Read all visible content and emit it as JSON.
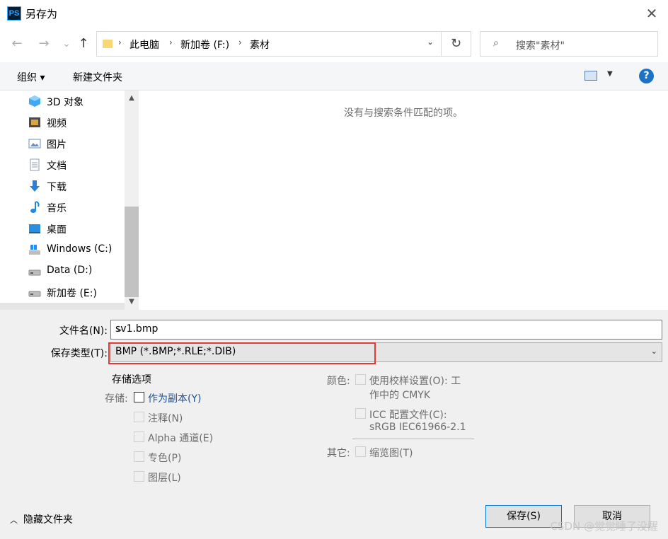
{
  "window": {
    "app_icon": "PS",
    "title": "另存为",
    "close_glyph": "✕"
  },
  "nav": {
    "back_glyph": "←",
    "forward_glyph": "→",
    "recent_glyph": "⌄",
    "up_glyph": "↑",
    "breadcrumbs": [
      "此电脑",
      "新加卷 (F:)",
      "素材"
    ],
    "crumb_separator": "›",
    "dropdown_glyph": "⌄",
    "refresh_glyph": "↻",
    "search_placeholder": "搜索\"素材\"",
    "search_glyph": "⌕"
  },
  "toolbar": {
    "organize_label": "组织 ▾",
    "new_folder_label": "新建文件夹",
    "view_dropdown_glyph": "▼",
    "help_glyph": "?"
  },
  "sidebar": {
    "items": [
      {
        "label": "3D 对象",
        "icon": "3d-objects-icon",
        "color": "#3fa9f5"
      },
      {
        "label": "视频",
        "icon": "video-icon",
        "color": "#4a4a4a"
      },
      {
        "label": "图片",
        "icon": "pictures-icon",
        "color": "#6b8fbf"
      },
      {
        "label": "文档",
        "icon": "documents-icon",
        "color": "#8a9bb0"
      },
      {
        "label": "下载",
        "icon": "downloads-icon",
        "color": "#2e7fd6"
      },
      {
        "label": "音乐",
        "icon": "music-icon",
        "color": "#1e88e5"
      },
      {
        "label": "桌面",
        "icon": "desktop-icon",
        "color": "#2b8de0"
      },
      {
        "label": "Windows (C:)",
        "icon": "windows-drive-icon",
        "color": "#999999"
      },
      {
        "label": "Data (D:)",
        "icon": "drive-icon",
        "color": "#999999"
      },
      {
        "label": "新加卷 (E:)",
        "icon": "drive-icon",
        "color": "#999999"
      }
    ],
    "scroll_up_glyph": "▲",
    "scroll_down_glyph": "▼"
  },
  "content": {
    "empty_message": "没有与搜索条件匹配的项。"
  },
  "form": {
    "filename_label": "文件名(N):",
    "filename_value": "sv1.bmp",
    "filetype_label": "保存类型(T):",
    "filetype_value": "BMP (*.BMP;*.RLE;*.DIB)",
    "dropdown_glyph": "⌄"
  },
  "options": {
    "section_title": "存储选项",
    "storage_label": "存储:",
    "as_copy": "作为副本(Y)",
    "notes": "注释(N)",
    "alpha": "Alpha 通道(E)",
    "spot": "专色(P)",
    "layers": "图层(L)",
    "color_label": "颜色:",
    "proof_setup_1": "使用校样设置(O):  工",
    "proof_setup_2": "作中的 CMYK",
    "icc_1": "ICC 配置文件(C):",
    "icc_2": "sRGB IEC61966-2.1",
    "other_label": "其它:",
    "thumbnail": "缩览图(T)"
  },
  "footer": {
    "hide_folders": "隐藏文件夹",
    "hide_glyph": "︿",
    "save": "保存(S)",
    "cancel": "取消",
    "watermark": "CSDN @觉觉睡了没醒"
  }
}
